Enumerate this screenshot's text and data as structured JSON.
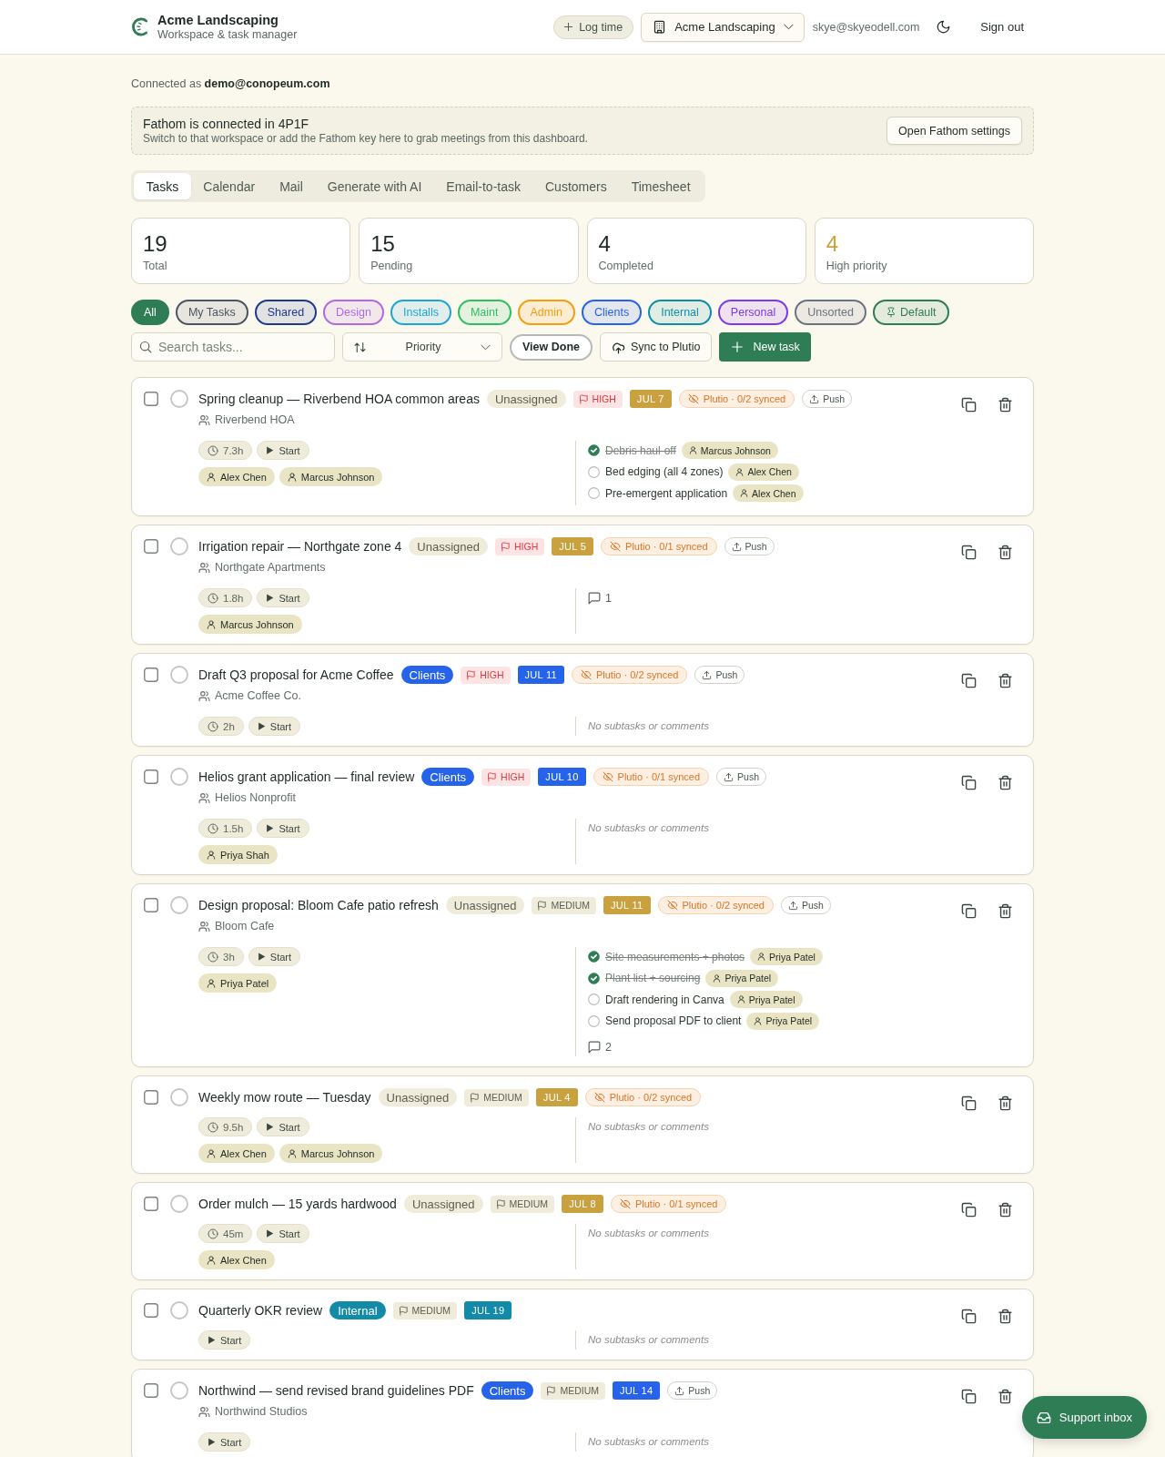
{
  "header": {
    "brand": "Acme Landscaping",
    "subtitle": "Workspace & task manager",
    "log_time": "Log time",
    "workspace": "Acme Landscaping",
    "email": "skye@skyeodell.com",
    "sign_out": "Sign out"
  },
  "connection": "Connected as **demo@conopeum.com**",
  "banner": {
    "title": "Fathom is connected in 4P1F",
    "text": "Switch to that workspace or add the Fathom key here to grab meetings from this dashboard.",
    "button": "Open Fathom settings"
  },
  "tabs": [
    {
      "label": "Tasks",
      "selected": true
    },
    {
      "label": "Calendar",
      "selected": false
    },
    {
      "label": "Mail",
      "selected": false
    },
    {
      "label": "Generate with AI",
      "selected": false
    },
    {
      "label": "Email-to-task",
      "selected": false
    },
    {
      "label": "Customers",
      "selected": false
    },
    {
      "label": "Timesheet",
      "selected": false
    }
  ],
  "stats": [
    {
      "value": "19",
      "label": "Total",
      "kind": "plain"
    },
    {
      "value": "15",
      "label": "Pending",
      "kind": "plain"
    },
    {
      "value": "4",
      "label": "Completed",
      "kind": "plain"
    },
    {
      "value": "4",
      "label": "High priority",
      "kind": "accent"
    }
  ],
  "filters": [
    {
      "label": "All",
      "color": "#2e7d55",
      "selected": true,
      "pinned": false
    },
    {
      "label": "My Tasks",
      "color": "#4b5563",
      "selected": false,
      "pinned": false
    },
    {
      "label": "Shared",
      "color": "#1e3a8a",
      "selected": false,
      "pinned": false
    },
    {
      "label": "Design",
      "color": "#b06ae6",
      "selected": false,
      "pinned": false
    },
    {
      "label": "Installs",
      "color": "#1ea5d8",
      "selected": false,
      "pinned": false
    },
    {
      "label": "Maint",
      "color": "#2fbf62",
      "selected": false,
      "pinned": false
    },
    {
      "label": "Admin",
      "color": "#f59e0b",
      "selected": false,
      "pinned": false
    },
    {
      "label": "Clients",
      "color": "#2563eb",
      "selected": false,
      "pinned": false
    },
    {
      "label": "Internal",
      "color": "#0e8fa8",
      "selected": false,
      "pinned": false
    },
    {
      "label": "Personal",
      "color": "#7c3aed",
      "selected": false,
      "pinned": false
    },
    {
      "label": "Unsorted",
      "color": "#6b7280",
      "selected": false,
      "pinned": false
    },
    {
      "label": "Default",
      "color": "#2e7d55",
      "selected": false,
      "pinned": true
    }
  ],
  "toolbar": {
    "search": {
      "placeholder": "Search tasks..."
    },
    "sort": "Priority",
    "view_done": "View Done",
    "sync": "Sync to Plutio",
    "new_task": "New task"
  },
  "tasks": [
    {
      "title": "Spring cleanup — Riverbend HOA common areas",
      "checked": false,
      "completed": false,
      "category": {
        "label": "Unassigned",
        "kind": "unassigned"
      },
      "priority": {
        "label": "HIGH",
        "kind": "high"
      },
      "due": {
        "label": "JUL 7",
        "color": "#c9a23f"
      },
      "sync": "Plutio · 0/2 synced",
      "push": "Push",
      "client": "Riverbend HOA",
      "time": "7.3h",
      "start": "Start",
      "assignees": [
        "Alex Chen",
        "Marcus Johnson"
      ],
      "subtasks": [
        {
          "text": "Debris haul-off",
          "done": true,
          "assignee": "Marcus Johnson"
        },
        {
          "text": "Bed edging (all 4 zones)",
          "done": false,
          "assignee": "Alex Chen"
        },
        {
          "text": "Pre-emergent application",
          "done": false,
          "assignee": "Alex Chen"
        }
      ]
    },
    {
      "title": "Irrigation repair — Northgate zone 4",
      "checked": false,
      "completed": false,
      "category": {
        "label": "Unassigned",
        "kind": "unassigned"
      },
      "priority": {
        "label": "HIGH",
        "kind": "high"
      },
      "due": {
        "label": "JUL 5",
        "color": "#c9a23f"
      },
      "sync": "Plutio · 0/1 synced",
      "push": "Push",
      "client": "Northgate Apartments",
      "time": "1.8h",
      "start": "Start",
      "assignees": [
        "Marcus Johnson"
      ],
      "comments": "1"
    },
    {
      "title": "Draft Q3 proposal for Acme Coffee",
      "checked": false,
      "completed": false,
      "category": {
        "label": "Clients",
        "kind": "tag",
        "color": "#2563eb"
      },
      "priority": {
        "label": "HIGH",
        "kind": "high"
      },
      "due": {
        "label": "JUL 11",
        "color": "#2563eb"
      },
      "sync": "Plutio · 0/2 synced",
      "push": "Push",
      "client": "Acme Coffee Co.",
      "time": "2h",
      "start": "Start",
      "note": "No subtasks or comments"
    },
    {
      "title": "Helios grant application — final review",
      "checked": false,
      "completed": false,
      "category": {
        "label": "Clients",
        "kind": "tag",
        "color": "#2563eb"
      },
      "priority": {
        "label": "HIGH",
        "kind": "high"
      },
      "due": {
        "label": "JUL 10",
        "color": "#2563eb"
      },
      "sync": "Plutio · 0/1 synced",
      "push": "Push",
      "client": "Helios Nonprofit",
      "time": "1.5h",
      "start": "Start",
      "assignees": [
        "Priya Shah"
      ],
      "note": "No subtasks or comments"
    },
    {
      "title": "Design proposal: Bloom Cafe patio refresh",
      "checked": false,
      "completed": false,
      "category": {
        "label": "Unassigned",
        "kind": "unassigned"
      },
      "priority": {
        "label": "MEDIUM",
        "kind": "medium"
      },
      "due": {
        "label": "JUL 11",
        "color": "#c9a23f"
      },
      "sync": "Plutio · 0/2 synced",
      "push": "Push",
      "client": "Bloom Cafe",
      "time": "3h",
      "start": "Start",
      "assignees": [
        "Priya Patel"
      ],
      "subtasks": [
        {
          "text": "Site measurements + photos",
          "done": true,
          "assignee": "Priya Patel"
        },
        {
          "text": "Plant list + sourcing",
          "done": true,
          "assignee": "Priya Patel"
        },
        {
          "text": "Draft rendering in Canva",
          "done": false,
          "assignee": "Priya Patel"
        },
        {
          "text": "Send proposal PDF to client",
          "done": false,
          "assignee": "Priya Patel"
        }
      ],
      "comments": "2"
    },
    {
      "title": "Weekly mow route — Tuesday",
      "checked": false,
      "completed": false,
      "category": {
        "label": "Unassigned",
        "kind": "unassigned"
      },
      "priority": {
        "label": "MEDIUM",
        "kind": "medium"
      },
      "due": {
        "label": "JUL 4",
        "color": "#c9a23f"
      },
      "sync": "Plutio · 0/2 synced",
      "time": "9.5h",
      "start": "Start",
      "assignees": [
        "Alex Chen",
        "Marcus Johnson"
      ],
      "note": "No subtasks or comments"
    },
    {
      "title": "Order mulch — 15 yards hardwood",
      "checked": false,
      "completed": false,
      "category": {
        "label": "Unassigned",
        "kind": "unassigned"
      },
      "priority": {
        "label": "MEDIUM",
        "kind": "medium"
      },
      "due": {
        "label": "JUL 8",
        "color": "#c9a23f"
      },
      "sync": "Plutio · 0/1 synced",
      "time": "45m",
      "start": "Start",
      "assignees": [
        "Alex Chen"
      ],
      "note": "No subtasks or comments"
    },
    {
      "title": "Quarterly OKR review",
      "checked": false,
      "completed": false,
      "category": {
        "label": "Internal",
        "kind": "tag",
        "color": "#138ba8"
      },
      "priority": {
        "label": "MEDIUM",
        "kind": "medium"
      },
      "due": {
        "label": "JUL 19",
        "color": "#138ba8"
      },
      "start": "Start",
      "note": "No subtasks or comments"
    },
    {
      "title": "Northwind — send revised brand guidelines PDF",
      "checked": false,
      "completed": false,
      "category": {
        "label": "Clients",
        "kind": "tag",
        "color": "#2563eb"
      },
      "priority": {
        "label": "MEDIUM",
        "kind": "medium"
      },
      "due": {
        "label": "JUL 14",
        "color": "#2563eb"
      },
      "push": "Push",
      "client": "Northwind Studios",
      "start": "Start",
      "note": "No subtasks or comments"
    }
  ],
  "support": "Support inbox"
}
